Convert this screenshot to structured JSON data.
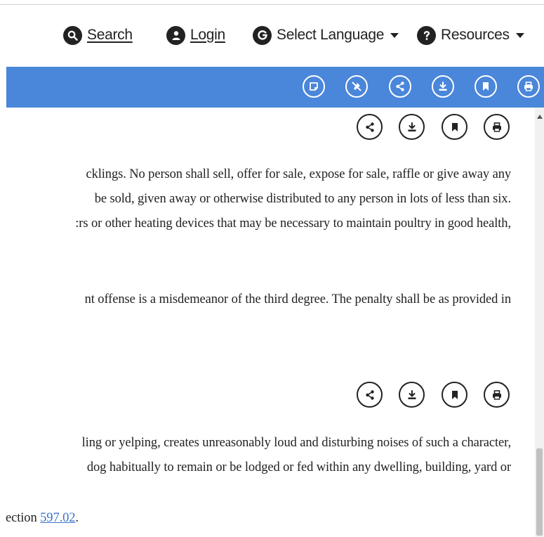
{
  "nav": {
    "search_label": "Search",
    "login_label": "Login",
    "language_label": "Select Language",
    "resources_label": "Resources"
  },
  "toolbar": {
    "icons": [
      "note-icon",
      "highlight-off-icon",
      "share-icon",
      "download-icon",
      "bookmark-icon",
      "print-icon"
    ],
    "accent_color": "#4a86d9"
  },
  "sections": [
    {
      "lines": [
        "cklings.  No person shall sell, offer for sale, expose for sale, raffle or give away any",
        "be sold, given away or otherwise distributed to any person in lots of less than six.",
        ":rs or other heating devices that may be necessary to maintain poultry in good health,",
        "nt offense is a misdemeanor of the third degree.  The penalty shall be as provided in"
      ]
    },
    {
      "lines": [
        "ling or yelping, creates unreasonably loud and disturbing noises of such a character,",
        "dog habitually to remain or be lodged or fed within any dwelling, building, yard or"
      ],
      "tail_prefix": "ection ",
      "tail_link": "597.02",
      "tail_suffix": "."
    }
  ]
}
